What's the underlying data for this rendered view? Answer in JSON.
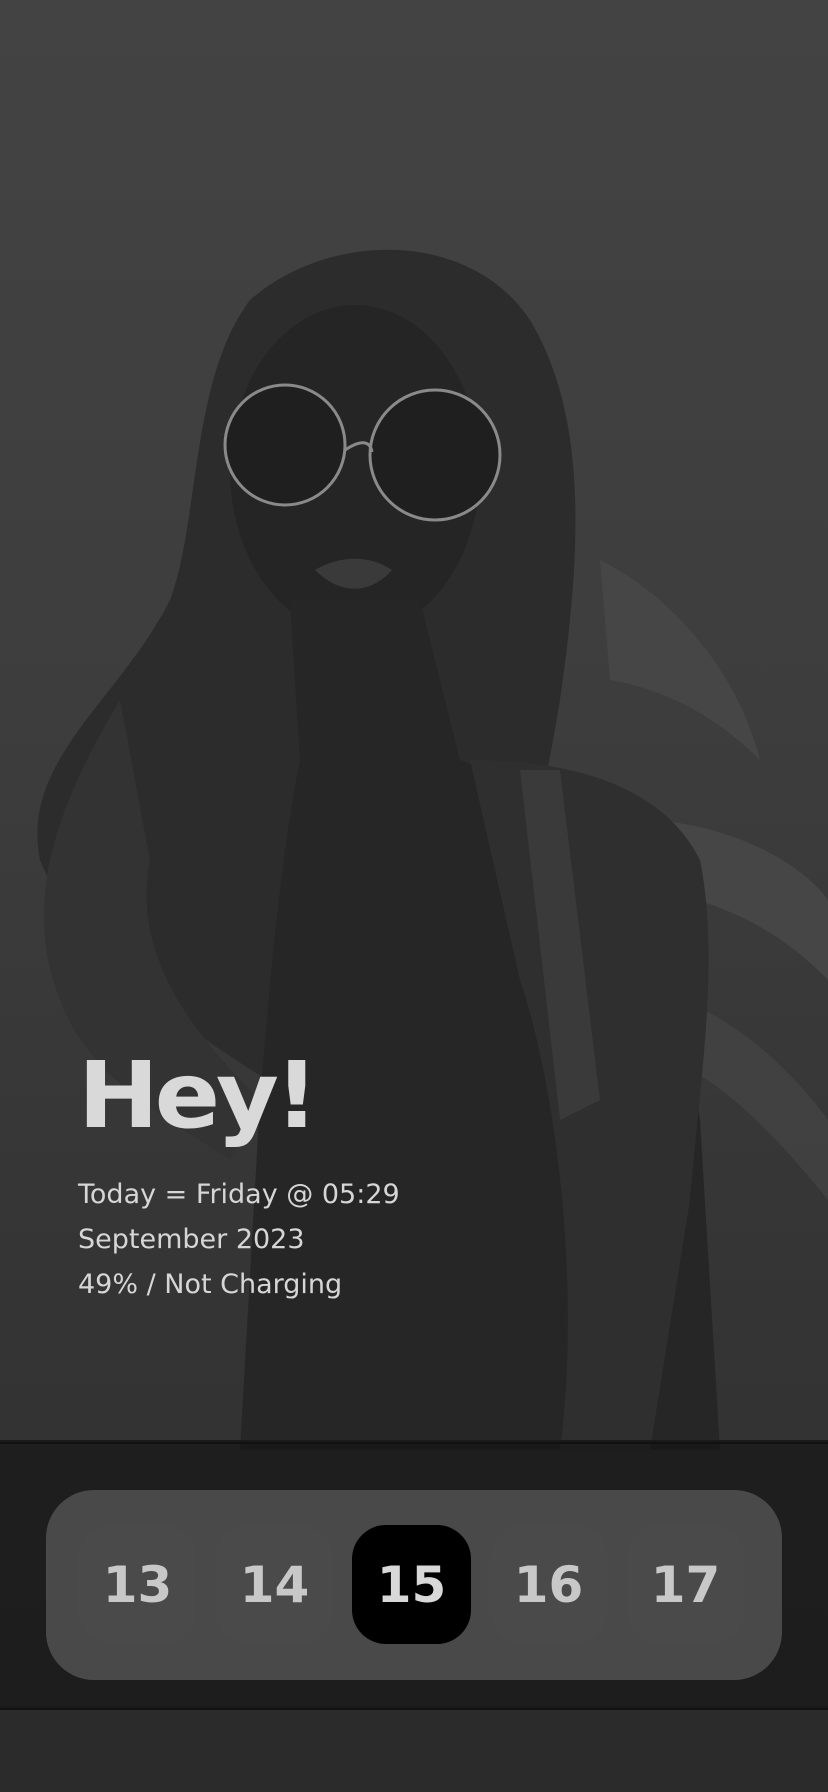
{
  "greeting": {
    "title": "Hey!",
    "today_line": "Today = Friday @ 05:29",
    "month_line": "September 2023",
    "battery_line": "49% / Not Charging"
  },
  "dock": {
    "days": [
      {
        "label": "13",
        "active": false
      },
      {
        "label": "14",
        "active": false
      },
      {
        "label": "15",
        "active": true
      },
      {
        "label": "16",
        "active": false
      },
      {
        "label": "17",
        "active": false
      }
    ]
  },
  "colors": {
    "background": "#3d3d3d",
    "text": "#d6d6d6",
    "day_tile": "#4a4a4a",
    "day_tile_active": "#000000",
    "dock_panel": "#6e6e6e"
  }
}
